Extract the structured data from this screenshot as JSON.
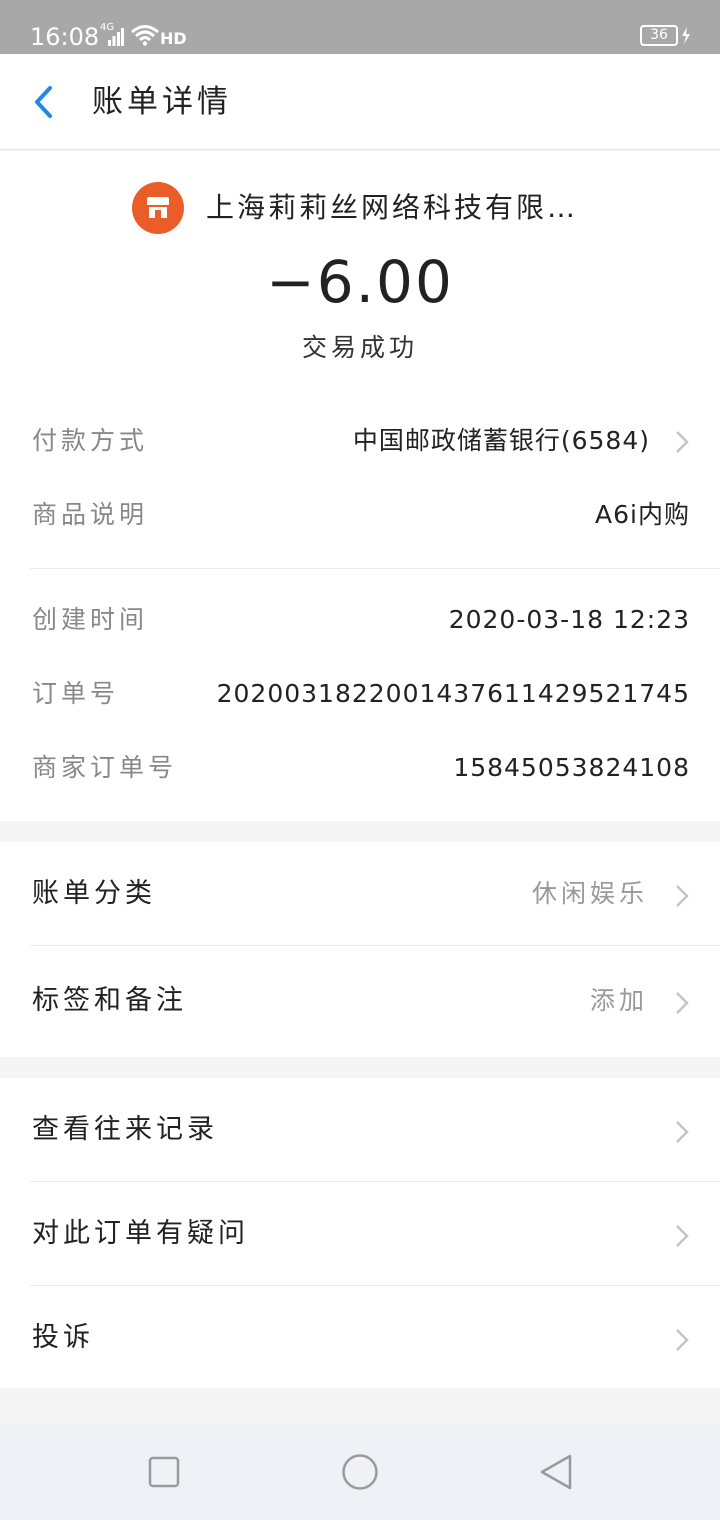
{
  "status_bar": {
    "time": "16:08",
    "network": "4G",
    "hd": "HD",
    "battery": "36"
  },
  "header": {
    "title": "账单详情",
    "back_icon": "chevron-left-icon"
  },
  "transaction": {
    "merchant_icon": "shop-icon",
    "merchant_name": "上海莉莉丝网络科技有限…",
    "amount": "−6.00",
    "status": "交易成功"
  },
  "payment_info": [
    {
      "label": "付款方式",
      "value": "中国邮政储蓄银行(6584)"
    },
    {
      "label": "商品说明",
      "value": "A6i内购"
    }
  ],
  "order_info": [
    {
      "label": "创建时间",
      "value": "2020-03-18 12:23"
    },
    {
      "label": "订单号",
      "value": "2020031822001437611429521745"
    },
    {
      "label": "商家订单号",
      "value": "15845053824108"
    }
  ],
  "settings": [
    {
      "label": "账单分类",
      "value": "休闲娱乐"
    },
    {
      "label": "标签和备注",
      "value": "添加"
    }
  ],
  "actions": [
    {
      "label": "查看往来记录"
    },
    {
      "label": "对此订单有疑问"
    },
    {
      "label": "投诉"
    }
  ],
  "colors": {
    "accent": "#1f8ae6",
    "merchant_logo": "#ea5c28",
    "status_bar": "#a8a8a8"
  }
}
